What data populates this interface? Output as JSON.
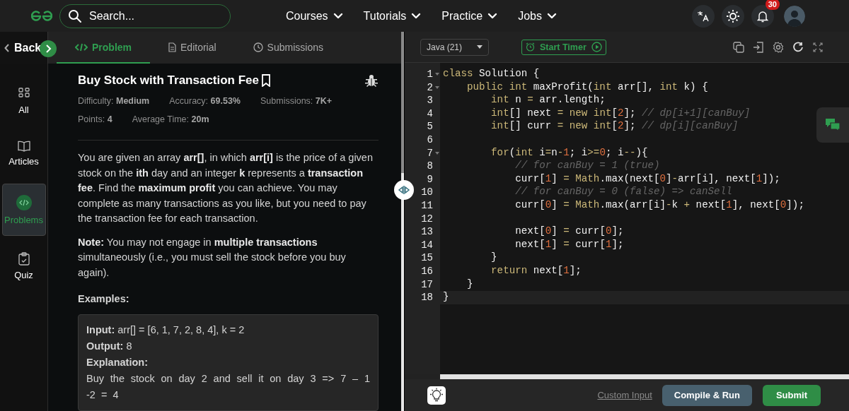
{
  "header": {
    "search": {
      "placeholder": "Search..."
    },
    "nav": [
      {
        "label": "Courses"
      },
      {
        "label": "Tutorials"
      },
      {
        "label": "Practice"
      },
      {
        "label": "Jobs"
      }
    ],
    "notifications_badge": "30"
  },
  "back_button": "Back",
  "tabs": [
    {
      "label": "Problem",
      "selected": true
    },
    {
      "label": "Editorial",
      "selected": false
    },
    {
      "label": "Submissions",
      "selected": false
    }
  ],
  "sidebar": {
    "items": [
      {
        "label": "All",
        "kind": "grid",
        "selected": false
      },
      {
        "label": "Articles",
        "kind": "book",
        "selected": false
      },
      {
        "label": "Problems",
        "kind": "code",
        "selected": true
      },
      {
        "label": "Quiz",
        "kind": "clipboard",
        "selected": false
      }
    ]
  },
  "problem": {
    "title": "Buy Stock with Transaction Fee",
    "meta_rows": [
      [
        {
          "label": "Difficulty:",
          "value": "Medium"
        },
        {
          "label": "Accuracy:",
          "value": "69.53%"
        },
        {
          "label": "Submissions:",
          "value": "7K+"
        }
      ],
      [
        {
          "label": "Points:",
          "value": "4"
        },
        {
          "label": "Average Time:",
          "value": "20m"
        }
      ]
    ],
    "paragraphs": [
      "You are given an array **arr[]**, in which **arr[i]** is the price of a given stock on the **ith** day and an integer **k** represents a **transaction fee**. Find the **maximum profit** you can achieve. You may complete as many transactions as you like, but you need to pay the transaction fee for each transaction.",
      "**Note:** You may not engage in **multiple transactions** simultaneously (i.e., you must sell the stock before you buy again)."
    ],
    "examples_heading": "Examples:",
    "example": {
      "input_label": "Input:",
      "input": "arr[] = [6, 1, 7, 2, 8, 4], k = 2",
      "output_label": "Output:",
      "output": "8",
      "explanation_label": "Explanation:",
      "explanation": "Buy the stock on day 2 and sell it on day 3 => 7 – 1 -2 = 4"
    }
  },
  "editor": {
    "language": "Java (21)",
    "timer_button": "Start Timer",
    "lines": [
      {
        "number": "1",
        "fold": true,
        "active": false,
        "tokens": [
          {
            "kind": "kw",
            "text": "class"
          },
          {
            "kind": "pl",
            "text": " Solution {"
          }
        ]
      },
      {
        "number": "2",
        "fold": true,
        "active": false,
        "tokens": [
          {
            "kind": "kw",
            "text": "    public"
          },
          {
            "kind": "kw",
            "text": " int"
          },
          {
            "kind": "pl",
            "text": " maxProfit("
          },
          {
            "kind": "kw",
            "text": "int"
          },
          {
            "kind": "pl",
            "text": " arr[], "
          },
          {
            "kind": "kw",
            "text": "int"
          },
          {
            "kind": "pl",
            "text": " k) {"
          }
        ]
      },
      {
        "number": "3",
        "fold": false,
        "active": false,
        "tokens": [
          {
            "kind": "kw",
            "text": "        int"
          },
          {
            "kind": "pl",
            "text": " n "
          },
          {
            "kind": "op",
            "text": "="
          },
          {
            "kind": "pl",
            "text": " arr.length;"
          }
        ]
      },
      {
        "number": "4",
        "fold": false,
        "active": false,
        "tokens": [
          {
            "kind": "kw",
            "text": "        int"
          },
          {
            "kind": "pl",
            "text": "[] next "
          },
          {
            "kind": "op",
            "text": "="
          },
          {
            "kind": "kw",
            "text": " new"
          },
          {
            "kind": "kw",
            "text": " int"
          },
          {
            "kind": "pl",
            "text": "["
          },
          {
            "kind": "num",
            "text": "2"
          },
          {
            "kind": "pl",
            "text": "];"
          },
          {
            "kind": "cm",
            "text": " // dp[i+1][canBuy]"
          }
        ]
      },
      {
        "number": "5",
        "fold": false,
        "active": false,
        "tokens": [
          {
            "kind": "kw",
            "text": "        int"
          },
          {
            "kind": "pl",
            "text": "[] curr "
          },
          {
            "kind": "op",
            "text": "="
          },
          {
            "kind": "kw",
            "text": " new"
          },
          {
            "kind": "kw",
            "text": " int"
          },
          {
            "kind": "pl",
            "text": "["
          },
          {
            "kind": "num",
            "text": "2"
          },
          {
            "kind": "pl",
            "text": "];"
          },
          {
            "kind": "cm",
            "text": " // dp[i][canBuy]"
          }
        ]
      },
      {
        "number": "6",
        "fold": false,
        "active": false
      },
      {
        "number": "7",
        "fold": true,
        "active": false,
        "tokens": [
          {
            "kind": "kw",
            "text": "        for"
          },
          {
            "kind": "pl",
            "text": "("
          },
          {
            "kind": "kw",
            "text": "int"
          },
          {
            "kind": "pl",
            "text": " i"
          },
          {
            "kind": "op",
            "text": "="
          },
          {
            "kind": "pl",
            "text": "n"
          },
          {
            "kind": "op",
            "text": "-"
          },
          {
            "kind": "num",
            "text": "1"
          },
          {
            "kind": "pl",
            "text": "; i"
          },
          {
            "kind": "op",
            "text": ">="
          },
          {
            "kind": "num",
            "text": "0"
          },
          {
            "kind": "pl",
            "text": "; i"
          },
          {
            "kind": "op",
            "text": "--"
          },
          {
            "kind": "pl",
            "text": "){"
          }
        ]
      },
      {
        "number": "8",
        "fold": false,
        "active": false,
        "tokens": [
          {
            "kind": "cm",
            "text": "            // for canBuy = 1 (true)"
          }
        ]
      },
      {
        "number": "9",
        "fold": false,
        "active": false,
        "tokens": [
          {
            "kind": "pl",
            "text": "            curr["
          },
          {
            "kind": "num",
            "text": "1"
          },
          {
            "kind": "pl",
            "text": "] "
          },
          {
            "kind": "op",
            "text": "="
          },
          {
            "kind": "kw",
            "text": " Math"
          },
          {
            "kind": "pl",
            "text": ".max(next["
          },
          {
            "kind": "num",
            "text": "0"
          },
          {
            "kind": "pl",
            "text": "]"
          },
          {
            "kind": "op",
            "text": "-"
          },
          {
            "kind": "pl",
            "text": "arr[i], next["
          },
          {
            "kind": "num",
            "text": "1"
          },
          {
            "kind": "pl",
            "text": "]);"
          }
        ]
      },
      {
        "number": "10",
        "fold": false,
        "active": false,
        "tokens": [
          {
            "kind": "cm",
            "text": "            // for canBuy = 0 (false) => canSell"
          }
        ]
      },
      {
        "number": "11",
        "fold": false,
        "active": false,
        "tokens": [
          {
            "kind": "pl",
            "text": "            curr["
          },
          {
            "kind": "num",
            "text": "0"
          },
          {
            "kind": "pl",
            "text": "] "
          },
          {
            "kind": "op",
            "text": "="
          },
          {
            "kind": "kw",
            "text": " Math"
          },
          {
            "kind": "pl",
            "text": ".max(arr[i]"
          },
          {
            "kind": "op",
            "text": "-"
          },
          {
            "kind": "pl",
            "text": "k "
          },
          {
            "kind": "op",
            "text": "+"
          },
          {
            "kind": "pl",
            "text": " next["
          },
          {
            "kind": "num",
            "text": "1"
          },
          {
            "kind": "pl",
            "text": "], next["
          },
          {
            "kind": "num",
            "text": "0"
          },
          {
            "kind": "pl",
            "text": "]);"
          }
        ]
      },
      {
        "number": "12",
        "fold": false,
        "active": false
      },
      {
        "number": "13",
        "fold": false,
        "active": false,
        "tokens": [
          {
            "kind": "pl",
            "text": "            next["
          },
          {
            "kind": "num",
            "text": "0"
          },
          {
            "kind": "pl",
            "text": "] "
          },
          {
            "kind": "op",
            "text": "="
          },
          {
            "kind": "pl",
            "text": " curr["
          },
          {
            "kind": "num",
            "text": "0"
          },
          {
            "kind": "pl",
            "text": "];"
          }
        ]
      },
      {
        "number": "14",
        "fold": false,
        "active": false,
        "tokens": [
          {
            "kind": "pl",
            "text": "            next["
          },
          {
            "kind": "num",
            "text": "1"
          },
          {
            "kind": "pl",
            "text": "] "
          },
          {
            "kind": "op",
            "text": "="
          },
          {
            "kind": "pl",
            "text": " curr["
          },
          {
            "kind": "num",
            "text": "1"
          },
          {
            "kind": "pl",
            "text": "];"
          }
        ]
      },
      {
        "number": "15",
        "fold": false,
        "active": false,
        "tokens": [
          {
            "kind": "pl",
            "text": "        }"
          }
        ]
      },
      {
        "number": "16",
        "fold": false,
        "active": false,
        "tokens": [
          {
            "kind": "kw",
            "text": "        return"
          },
          {
            "kind": "pl",
            "text": " next["
          },
          {
            "kind": "num",
            "text": "1"
          },
          {
            "kind": "pl",
            "text": "];"
          }
        ]
      },
      {
        "number": "17",
        "fold": false,
        "active": false,
        "tokens": [
          {
            "kind": "pl",
            "text": "    }"
          }
        ]
      },
      {
        "number": "18",
        "fold": false,
        "active": true,
        "tokens": [
          {
            "kind": "pl",
            "text": "}"
          }
        ]
      }
    ],
    "custom_input": "Custom Input",
    "compile_button": "Compile & Run",
    "submit_button": "Submit"
  }
}
